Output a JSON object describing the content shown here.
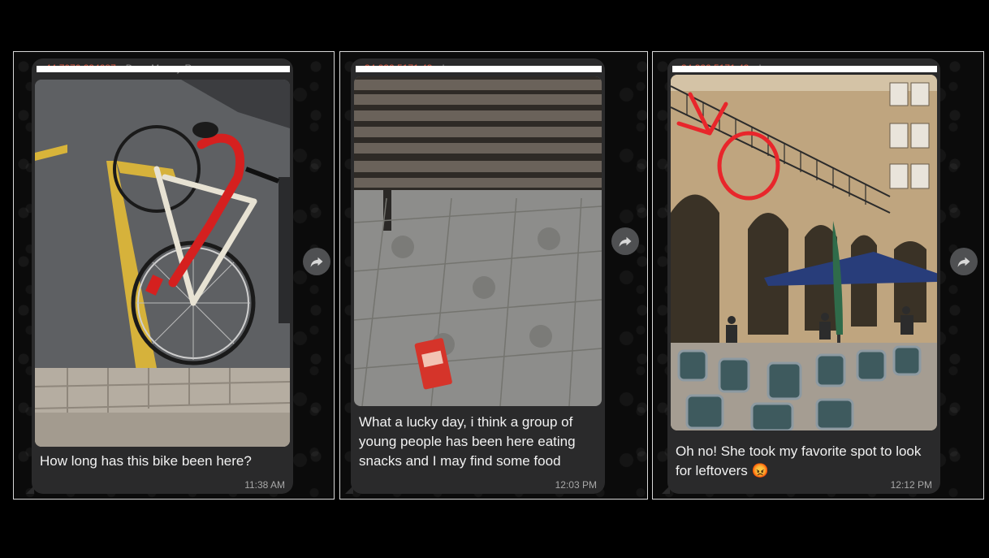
{
  "messages": [
    {
      "sender": "+44 7070 234287",
      "sender_extra": "Dave Murray-Ru...",
      "caption": "How long has this bike been here?",
      "time": "11:38 AM",
      "photo_icon": "bicycle-photo"
    },
    {
      "sender": "+34 932 5171 43",
      "sender_extra": "Irene",
      "caption": "What a lucky day, i think a group of young people has been here eating snacks and I may find some food",
      "time": "12:03 PM",
      "photo_icon": "bench-snack-photo"
    },
    {
      "sender": "+34 322 5171 43",
      "sender_extra": "Irene",
      "caption": "Oh no! She took my favorite spot to look for leftovers 😡",
      "time": "12:12 PM",
      "photo_icon": "plaza-cafe-photo"
    }
  ],
  "icons": {
    "forward": "forward-arrow-icon"
  },
  "colors": {
    "bubble": "#2a2a2b",
    "sender": "#e1563d",
    "annotation": "#e8262b"
  }
}
